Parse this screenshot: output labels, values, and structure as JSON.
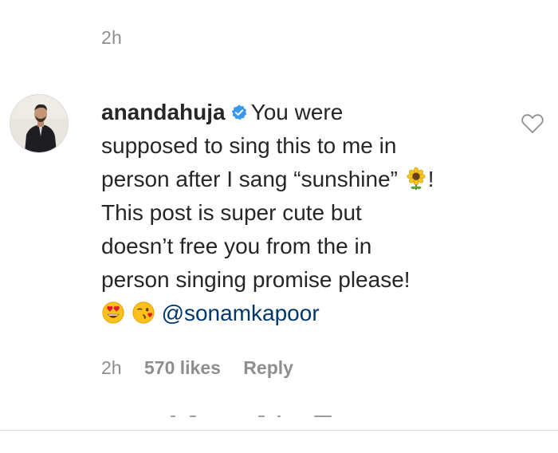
{
  "header": {
    "timestamp": "2h"
  },
  "comment": {
    "username": "anandahuja",
    "verified_icon": "verified-badge-icon",
    "lines": [
      "You were",
      "supposed to sing this to me in",
      "person after I sang “sunshine” ",
      "This post is super cute but",
      "doesn’t free you from the in",
      "person singing promise please!"
    ],
    "sunflower_emoji": "sunflower-emoji",
    "after_sunflower": "!",
    "emojis": [
      "heart-eyes-emoji",
      "kissing-winking-emoji"
    ],
    "mention": "@sonamkapoor",
    "like_icon": "heart-outline-icon"
  },
  "meta": {
    "time": "2h",
    "likes": "570 likes",
    "reply": "Reply"
  },
  "colors": {
    "text": "#262626",
    "muted": "#8e8e8e",
    "mention": "#00376b",
    "verified": "#3897f0",
    "divider": "#dbdbdb"
  }
}
